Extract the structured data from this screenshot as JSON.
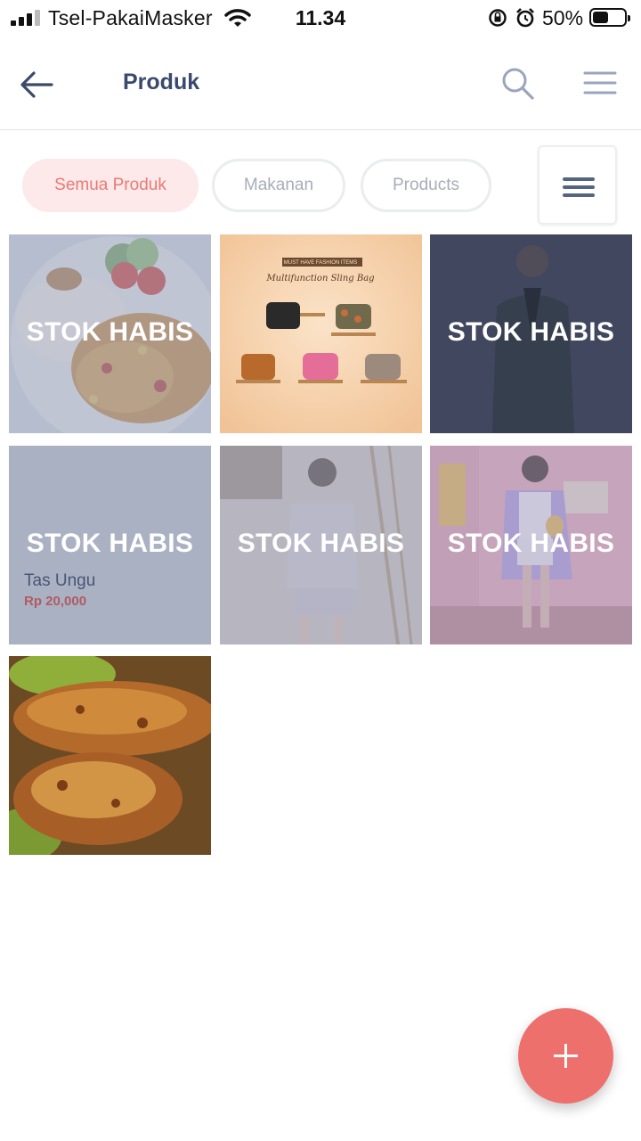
{
  "status_bar": {
    "carrier": "Tsel-PakaiMasker",
    "time": "11.34",
    "battery_percent": "50%",
    "battery_level": 0.5,
    "icons": [
      "signal-icon",
      "wifi-icon",
      "orientation-lock-icon",
      "alarm-icon",
      "battery-icon"
    ]
  },
  "header": {
    "title": "Produk",
    "icons": [
      "back-arrow-icon",
      "search-icon",
      "hamburger-menu-icon"
    ]
  },
  "filters": {
    "chips": [
      {
        "label": "Semua Produk",
        "active": true
      },
      {
        "label": "Makanan",
        "active": false
      },
      {
        "label": "Products",
        "active": false
      }
    ],
    "menu_icon": "hamburger-menu-icon"
  },
  "products": [
    {
      "image": "nasi-goreng-food-photo",
      "out_of_stock": true,
      "status_label": "STOK HABIS"
    },
    {
      "image": "sling-bag-promo-photo",
      "out_of_stock": false,
      "promo_banner": "MUST HAVE FASHION ITEMS",
      "promo_title": "Multifunction Sling Bag"
    },
    {
      "image": "man-in-suit-photo",
      "out_of_stock": true,
      "status_label": "STOK HABIS"
    },
    {
      "image": "placeholder",
      "out_of_stock": true,
      "status_label": "STOK HABIS",
      "name": "Tas Ungu",
      "price": "Rp 20,000"
    },
    {
      "image": "woman-loungewear-photo",
      "out_of_stock": true,
      "status_label": "STOK HABIS"
    },
    {
      "image": "woman-fashion-photo",
      "out_of_stock": true,
      "status_label": "STOK HABIS"
    },
    {
      "image": "grilled-chicken-photo",
      "out_of_stock": false
    }
  ],
  "colors": {
    "primary_text": "#3b4a6b",
    "accent": "#ee706c",
    "active_chip_bg": "#fde9e9",
    "price": "#b15b63"
  },
  "fab": {
    "icon": "plus-icon"
  }
}
